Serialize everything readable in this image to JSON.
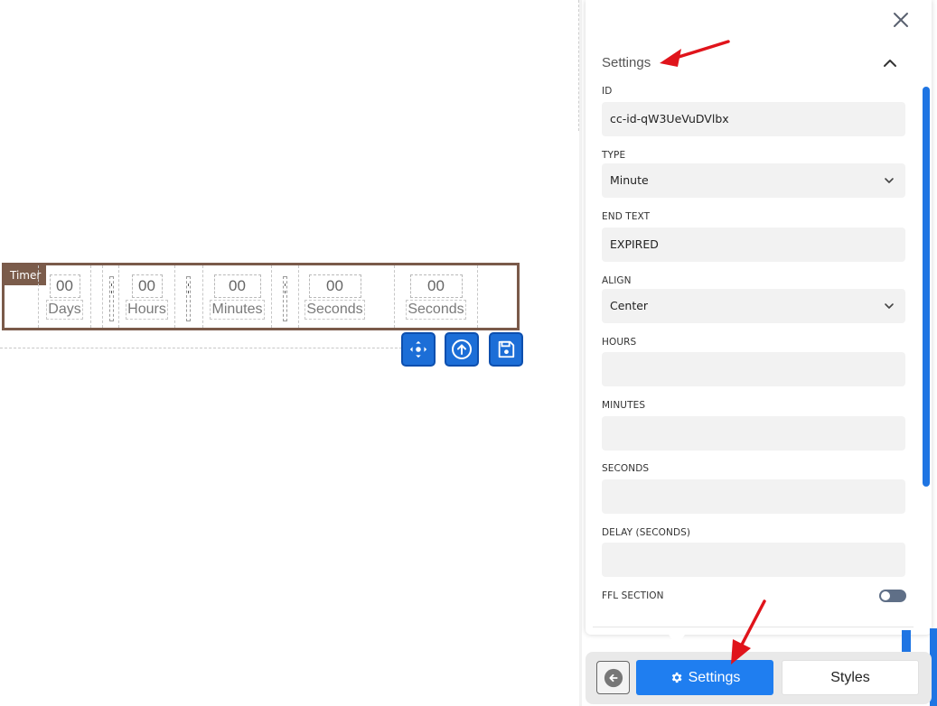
{
  "timer": {
    "badge": "Timer",
    "units": [
      {
        "value": "00",
        "label": "Days"
      },
      {
        "value": "00",
        "label": "Hours"
      },
      {
        "value": "00",
        "label": "Minutes"
      },
      {
        "value": "00",
        "label": "Seconds"
      },
      {
        "value": "00",
        "label": "Seconds"
      }
    ],
    "toolbar": [
      "move-icon",
      "arrow-up-circle-icon",
      "save-icon"
    ]
  },
  "panel": {
    "section_title": "Settings",
    "fields": {
      "id": {
        "label": "ID",
        "value": "cc-id-qW3UeVuDVlbx"
      },
      "type": {
        "label": "TYPE",
        "value": "Minute"
      },
      "end_text": {
        "label": "END TEXT",
        "value": "EXPIRED"
      },
      "align": {
        "label": "ALIGN",
        "value": "Center"
      },
      "hours": {
        "label": "HOURS",
        "value": ""
      },
      "minutes": {
        "label": "MINUTES",
        "value": ""
      },
      "seconds": {
        "label": "SECONDS",
        "value": ""
      },
      "delay": {
        "label": "DELAY (SECONDS)",
        "value": ""
      },
      "ffl_section": {
        "label": "FFL SECTION",
        "enabled": false
      }
    }
  },
  "tabs": {
    "settings_label": "Settings",
    "styles_label": "Styles",
    "active": "settings"
  },
  "colors": {
    "accent": "#1f7ef0",
    "timer_border": "#7a5a4a",
    "annotation_red": "#e0141b"
  }
}
